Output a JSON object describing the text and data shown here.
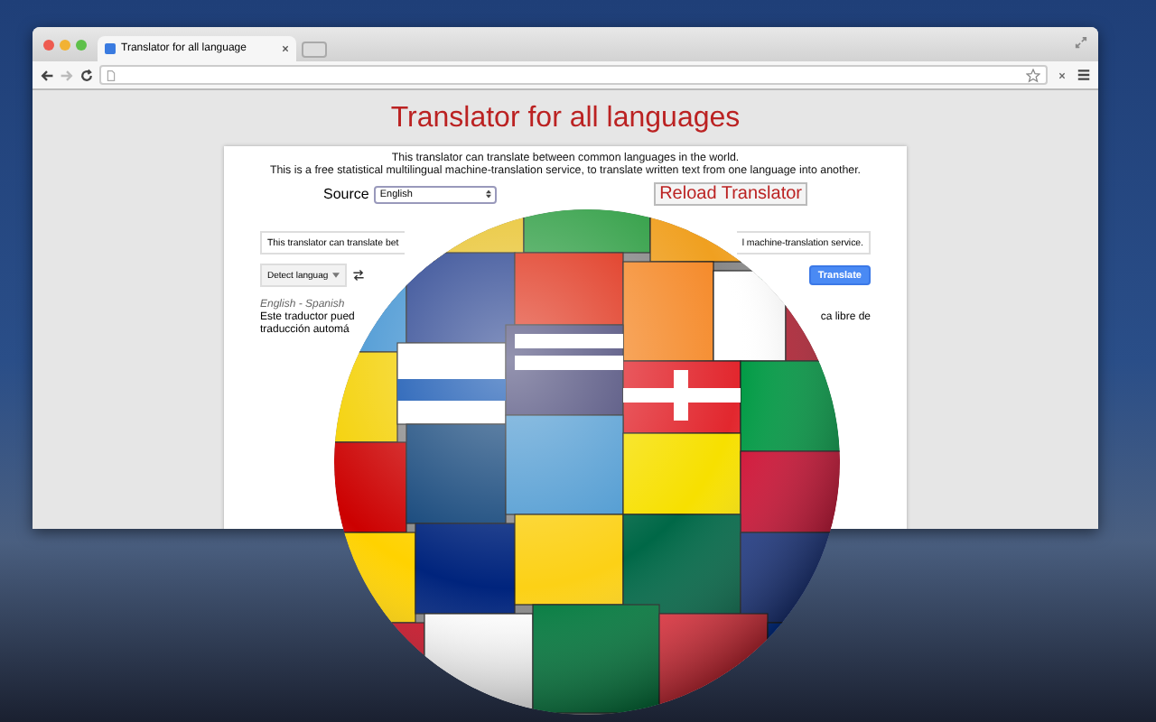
{
  "window": {
    "tab_title": "Translator for all language"
  },
  "page": {
    "title": "Translator for all languages",
    "intro": [
      "This translator can translate between common languages in the world.",
      "This is a free statistical multilingual machine-translation service, to translate written text from one language into another."
    ],
    "source_label": "Source",
    "source_value": "English",
    "reload_button": "Reload Translator"
  },
  "widget": {
    "input_parts": [
      "This translator can translate bet",
      "l machine-translation service."
    ],
    "detect_button": "Detect languag",
    "translate_button": "Translate",
    "pair_label": "English - Spanish",
    "output_lines": [
      [
        "Este traductor pued",
        "ca libre de"
      ],
      [
        "traducción automá"
      ]
    ]
  }
}
